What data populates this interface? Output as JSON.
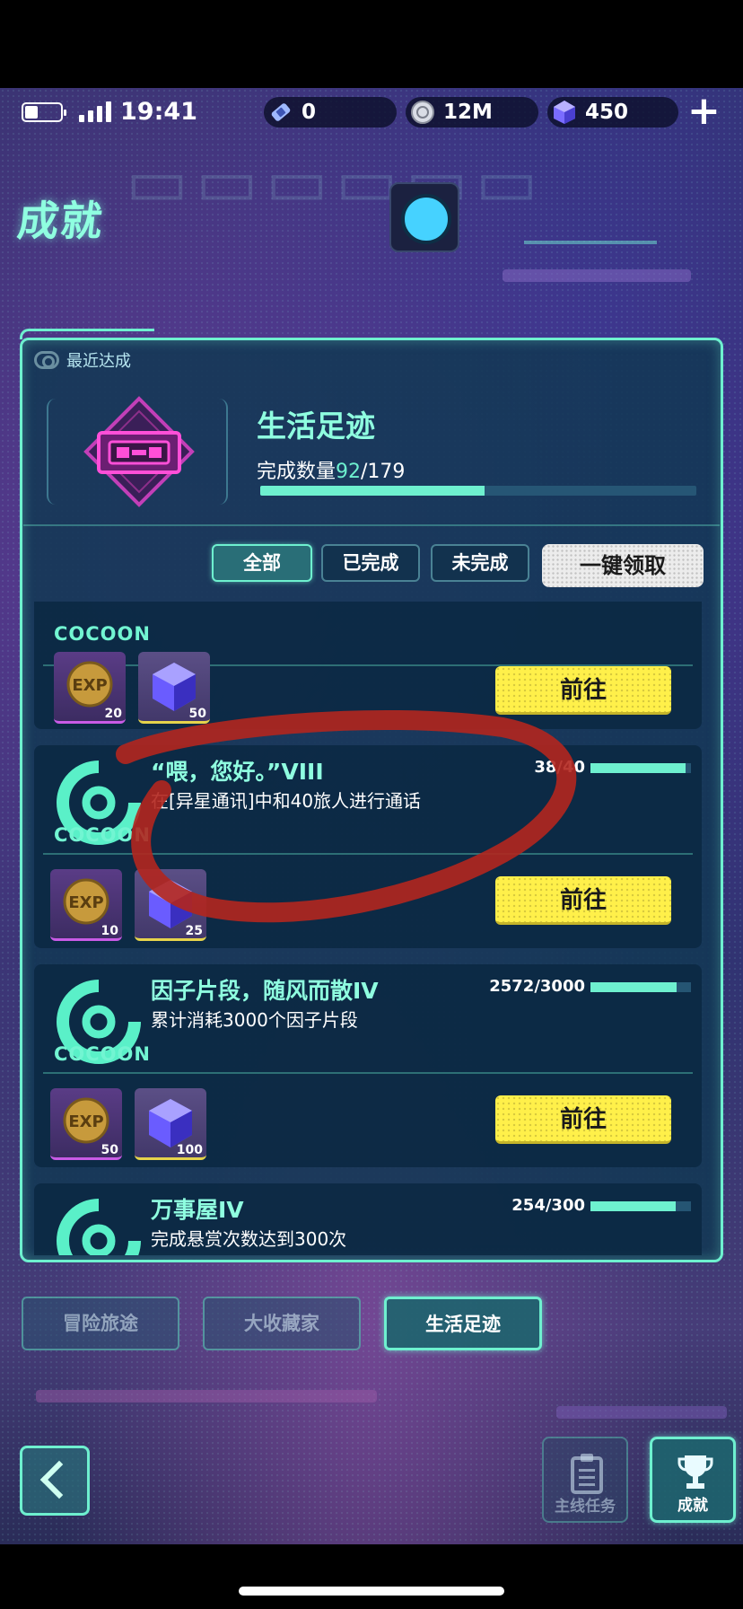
{
  "status_bar": {
    "time": "19:41"
  },
  "resources": [
    {
      "icon": "ticket-icon",
      "value": "0"
    },
    {
      "icon": "coin-ring-icon",
      "value": "12M"
    },
    {
      "icon": "cube-gem-icon",
      "value": "450"
    }
  ],
  "header": {
    "title": "成就"
  },
  "recent": {
    "label": "最近达成",
    "category_title": "生活足迹",
    "count_label": "完成数量",
    "count_current": "92",
    "count_total": "/179",
    "progress": 0.514
  },
  "filters": {
    "all": "全部",
    "completed": "已完成",
    "incomplete": "未完成",
    "claim_all": "一键领取"
  },
  "brand": "COCOON",
  "achievements": [
    {
      "title": "",
      "desc": "",
      "progress_text": "",
      "rewards": [
        {
          "type": "exp",
          "qty": "20"
        },
        {
          "type": "gem",
          "qty": "50"
        }
      ],
      "button": "前往"
    },
    {
      "title": "“喂，您好。”VIII",
      "desc": "在[异星通讯]中和40旅人进行通话",
      "progress_text": "38/40",
      "progress": 0.95,
      "rewards": [
        {
          "type": "exp",
          "qty": "10"
        },
        {
          "type": "gem",
          "qty": "25"
        }
      ],
      "button": "前往"
    },
    {
      "title": "因子片段，随风而散IV",
      "desc": "累计消耗3000个因子片段",
      "progress_text": "2572/3000",
      "progress": 0.857,
      "rewards": [
        {
          "type": "exp",
          "qty": "50"
        },
        {
          "type": "gem",
          "qty": "100"
        }
      ],
      "button": "前往"
    },
    {
      "title": "万事屋IV",
      "desc": "完成悬赏次数达到300次",
      "progress_text": "254/300",
      "progress": 0.847
    }
  ],
  "category_tabs": [
    "冒险旅途",
    "大收藏家",
    "生活足迹"
  ],
  "bottom_nav": {
    "quest": "主线任务",
    "achievement": "成就"
  },
  "colors": {
    "accent": "#6ef0cf",
    "button_yellow": "#fff04a",
    "annotation_red": "#b3261e"
  }
}
